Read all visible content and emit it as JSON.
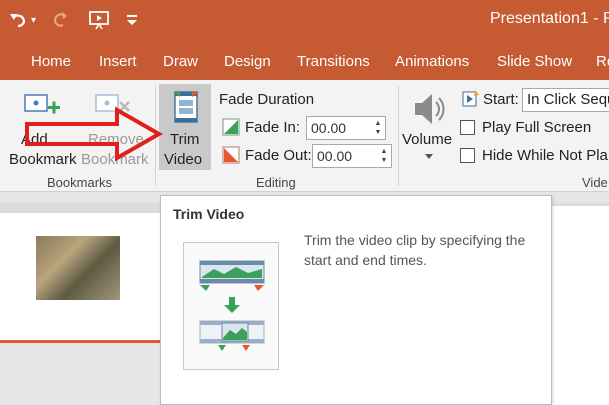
{
  "title_bar": {
    "document_title": "Presentation1",
    "app_suffix": " - P",
    "undo_icon": "undo-icon",
    "redo_icon": "redo-icon",
    "present_icon": "present-from-start-icon",
    "customize_icon": "customize-qat-icon",
    "dropdown_glyph": "▾"
  },
  "tabs": [
    "Home",
    "Insert",
    "Draw",
    "Design",
    "Transitions",
    "Animations",
    "Slide Show",
    "Re"
  ],
  "ribbon": {
    "bookmarks_group": {
      "label": "Bookmarks",
      "add_line1": "Add",
      "add_line2": "Bookmark",
      "remove_line1": "Remove",
      "remove_line2": "Bookmark"
    },
    "editing_group": {
      "label": "Editing",
      "trim_line1": "Trim",
      "trim_line2": "Video",
      "fade_duration": "Fade Duration",
      "fade_in_label": "Fade In:",
      "fade_in_value": "00.00",
      "fade_out_label": "Fade Out:",
      "fade_out_value": "00.00"
    },
    "video_options_group": {
      "label": "Vide",
      "volume_label": "Volume",
      "start_label": "Start:",
      "start_value": "In Click Sequ",
      "play_full_screen": "Play Full Screen",
      "hide_while_not_playing": "Hide While Not Pla"
    }
  },
  "tooltip": {
    "title": "Trim Video",
    "description": "Trim the video clip by specifying the start and end times."
  },
  "colors": {
    "accent": "#c55a33",
    "arrow": "#e01f1f",
    "ribbon_bg": "#f3f3f3",
    "selected": "#c9c9c9"
  }
}
